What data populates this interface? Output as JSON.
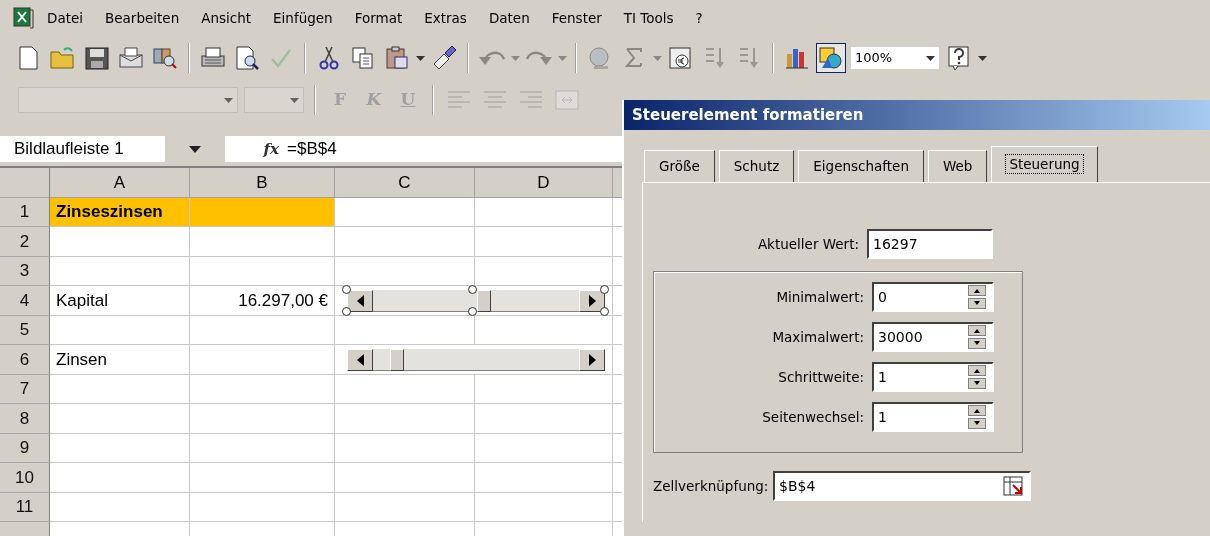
{
  "menu": [
    {
      "kind": "app-icon"
    },
    {
      "label": "Datei"
    },
    {
      "label": "Bearbeiten"
    },
    {
      "label": "Ansicht"
    },
    {
      "label": "Einfügen"
    },
    {
      "label": "Format"
    },
    {
      "label": "Extras"
    },
    {
      "label": "Daten"
    },
    {
      "label": "Fenster"
    },
    {
      "label": "TI Tools"
    },
    {
      "label": "?"
    }
  ],
  "toolbar": [
    {
      "kind": "new",
      "disabled": false
    },
    {
      "kind": "open",
      "disabled": false
    },
    {
      "kind": "save",
      "disabled": false
    },
    {
      "kind": "mail",
      "disabled": false
    },
    {
      "kind": "research",
      "disabled": false
    },
    {
      "kind": "separator"
    },
    {
      "kind": "print",
      "disabled": false
    },
    {
      "kind": "preview",
      "disabled": false
    },
    {
      "kind": "spelling",
      "disabled": true
    },
    {
      "kind": "separator"
    },
    {
      "kind": "cut",
      "disabled": false
    },
    {
      "kind": "copy",
      "disabled": false
    },
    {
      "kind": "paste",
      "disabled": false,
      "dropdown": true
    },
    {
      "kind": "painter",
      "disabled": false
    },
    {
      "kind": "separator"
    },
    {
      "kind": "undo",
      "disabled": true,
      "dropdown": true
    },
    {
      "kind": "redo",
      "disabled": true,
      "dropdown": true
    },
    {
      "kind": "separator"
    },
    {
      "kind": "hyperlink",
      "disabled": true
    },
    {
      "kind": "sum",
      "disabled": true,
      "dropdown": true
    },
    {
      "kind": "euro",
      "disabled": false
    },
    {
      "kind": "sort-asc",
      "disabled": true
    },
    {
      "kind": "sort-desc",
      "disabled": true
    },
    {
      "kind": "separator"
    },
    {
      "kind": "chart",
      "disabled": false
    },
    {
      "kind": "drawing",
      "disabled": false,
      "pressed": true
    },
    {
      "kind": "zoom",
      "value": "100%"
    },
    {
      "kind": "help",
      "disabled": false
    },
    {
      "kind": "more"
    }
  ],
  "format_toolbar": [
    {
      "kind": "font-combo",
      "disabled": true
    },
    {
      "kind": "size-combo",
      "disabled": true
    },
    {
      "kind": "separator"
    },
    {
      "kind": "bold",
      "label": "F",
      "disabled": true
    },
    {
      "kind": "italic",
      "label": "K",
      "disabled": true
    },
    {
      "kind": "underline",
      "label": "U",
      "disabled": true
    },
    {
      "kind": "separator"
    },
    {
      "kind": "align-left",
      "disabled": true
    },
    {
      "kind": "align-center",
      "disabled": true
    },
    {
      "kind": "align-right",
      "disabled": true
    },
    {
      "kind": "merge",
      "disabled": true
    }
  ],
  "formula_bar": {
    "name_box": "Bildlaufleiste 1",
    "fx": "fx",
    "formula": "=$B$4"
  },
  "sheet": {
    "columns": [
      "A",
      "B",
      "C",
      "D"
    ],
    "rows": [
      {
        "number": "1",
        "a": "Zinseszinsen",
        "heading": true
      },
      {
        "number": "2"
      },
      {
        "number": "3"
      },
      {
        "number": "4",
        "a": "Kapital",
        "b": "16.297,00 €",
        "scrollbar": {
          "selected": true
        }
      },
      {
        "number": "5"
      },
      {
        "number": "6",
        "a": "Zinsen",
        "scrollbar": {
          "selected": false
        }
      },
      {
        "number": "7"
      },
      {
        "number": "8"
      },
      {
        "number": "9"
      },
      {
        "number": "10"
      },
      {
        "number": "11"
      }
    ]
  },
  "dialog": {
    "title": "Steuerelement formatieren",
    "tabs": [
      {
        "label": "Größe",
        "selected": false
      },
      {
        "label": "Schutz",
        "selected": false
      },
      {
        "label": "Eigenschaften",
        "selected": false
      },
      {
        "label": "Web",
        "selected": false
      },
      {
        "label": "Steuerung",
        "selected": true
      }
    ],
    "current_value": {
      "label": "Aktueller Wert:",
      "value": "16297"
    },
    "spin_fields": [
      {
        "label": "Minimalwert:",
        "value": "0"
      },
      {
        "label": "Maximalwert:",
        "value": "30000"
      },
      {
        "label": "Schrittweite:",
        "value": "1"
      },
      {
        "label": "Seitenwechsel:",
        "value": "1"
      }
    ],
    "cell_link": {
      "label": "Zellverknüpfung:",
      "value": "$B$4"
    }
  }
}
